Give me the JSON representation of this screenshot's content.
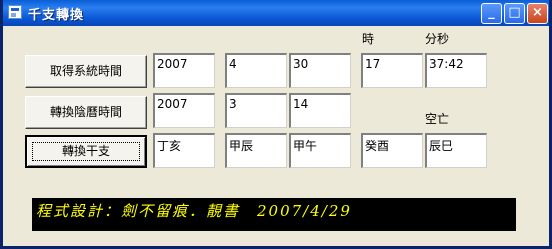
{
  "window": {
    "title": "千支轉換",
    "icons": {
      "app": "app-window-icon",
      "minimize": "minimize-icon",
      "maximize": "maximize-icon",
      "close": "close-icon"
    },
    "glyphs": {
      "minimize": "_",
      "maximize": "□",
      "close": "×"
    }
  },
  "buttons": {
    "get_time": "取得系統時間",
    "convert_lunar": "轉換陰曆時間",
    "convert_ganzhi": "轉換干支"
  },
  "labels": {
    "hour": "時",
    "min_sec": "分秒",
    "kongwang": "空亡"
  },
  "rows": {
    "system_time": [
      "2007",
      "4",
      "30",
      "17",
      "37:42"
    ],
    "lunar": [
      "2007",
      "3",
      "14"
    ],
    "ganzhi": [
      "丁亥",
      "甲辰",
      "甲午",
      "癸酉",
      "辰巳"
    ]
  },
  "footer": {
    "text": "程式設計：劍不留痕．靚書　2007/4/29",
    "color": "#ffff00"
  }
}
